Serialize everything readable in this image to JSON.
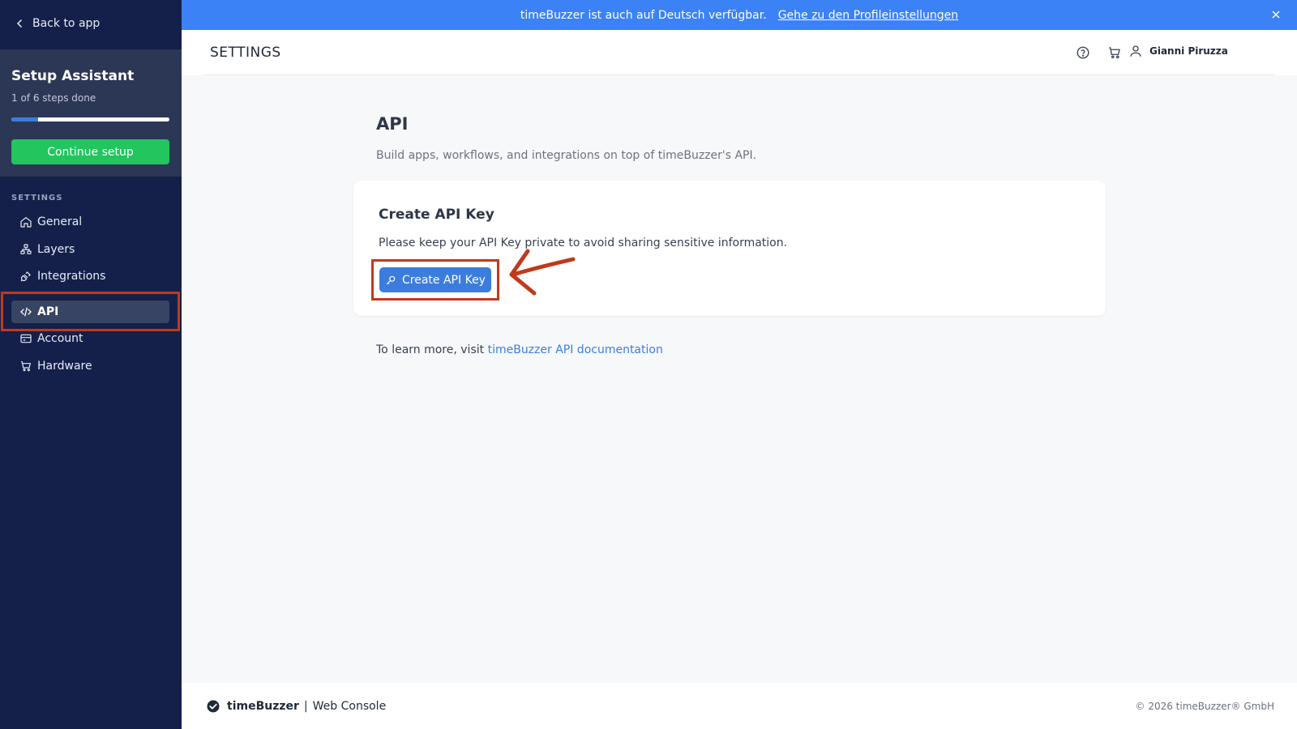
{
  "sidebar": {
    "back_label": "Back to app",
    "setup": {
      "title": "Setup Assistant",
      "progress_text": "1 of 6 steps done",
      "progress_percent": 16.7,
      "continue_label": "Continue setup"
    },
    "section_label": "SETTINGS",
    "items": [
      {
        "label": "General",
        "icon": "home-icon"
      },
      {
        "label": "Layers",
        "icon": "layers-icon"
      },
      {
        "label": "Integrations",
        "icon": "plug-icon"
      },
      {
        "label": "API",
        "icon": "code-icon",
        "active": true
      },
      {
        "label": "Account",
        "icon": "card-icon"
      },
      {
        "label": "Hardware",
        "icon": "cart-icon"
      }
    ]
  },
  "banner": {
    "text": "timeBuzzer ist auch auf Deutsch verfügbar.",
    "link": "Gehe zu den Profileinstellungen"
  },
  "header": {
    "title": "SETTINGS",
    "user_name": "Gianni Piruzza"
  },
  "main": {
    "title": "API",
    "subtitle": "Build apps, workflows, and integrations on top of timeBuzzer's API.",
    "card": {
      "title": "Create API Key",
      "text": "Please keep your API Key private to avoid sharing sensitive information.",
      "button_label": "Create API Key"
    },
    "learn_prefix": "To learn more, visit",
    "learn_link": "timeBuzzer API documentation"
  },
  "footer": {
    "brand": "timeBuzzer",
    "brand_suffix": "Web Console",
    "copyright": "© 2026 timeBuzzer® GmbH"
  },
  "colors": {
    "sidebar_bg": "#14204a",
    "banner_bg": "#3b82f6",
    "primary": "#3b7ddd",
    "success": "#22c55e",
    "highlight": "#c0391b"
  }
}
